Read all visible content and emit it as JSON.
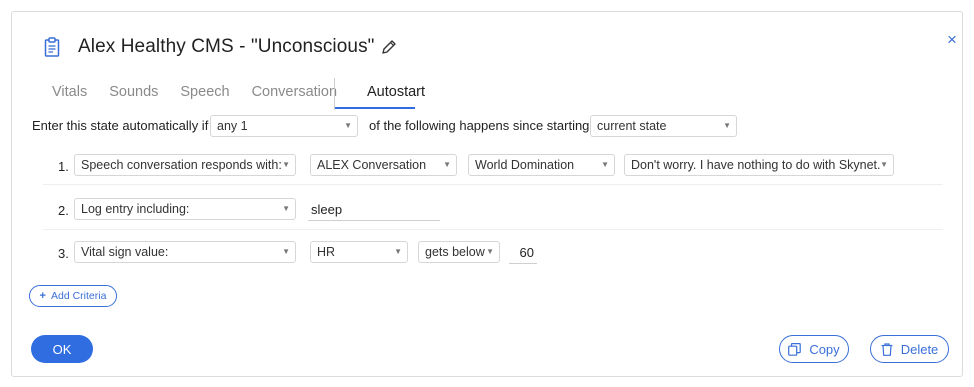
{
  "dialog": {
    "title": "Alex Healthy CMS - \"Unconscious\"",
    "close_glyph": "×"
  },
  "tabs": [
    {
      "label": "Vitals",
      "active": false
    },
    {
      "label": "Sounds",
      "active": false
    },
    {
      "label": "Speech",
      "active": false
    },
    {
      "label": "Conversation",
      "active": false
    },
    {
      "label": "Autostart",
      "active": true
    }
  ],
  "autostart": {
    "prefix": "Enter this state automatically if",
    "quantifier": "any 1",
    "middle": "of the following happens since starting",
    "reference": "current state",
    "criteria": [
      {
        "number": "1.",
        "type": "Speech conversation responds with:",
        "conversation": "ALEX Conversation",
        "topic": "World Domination",
        "response": "Don't worry. I have nothing to do with Skynet."
      },
      {
        "number": "2.",
        "type": "Log entry including:",
        "text": "sleep"
      },
      {
        "number": "3.",
        "type": "Vital sign value:",
        "vital": "HR",
        "comparison": "gets below",
        "value": "60"
      }
    ],
    "add_label": "Add Criteria"
  },
  "footer": {
    "ok_label": "OK",
    "copy_label": "Copy",
    "delete_label": "Delete"
  },
  "colors": {
    "accent": "#2f6de0",
    "border": "#d6d6d6"
  },
  "icons": {
    "header": "clipboard-icon",
    "edit": "pencil-icon",
    "close": "close-icon",
    "copy": "copy-icon",
    "delete": "trash-icon"
  }
}
